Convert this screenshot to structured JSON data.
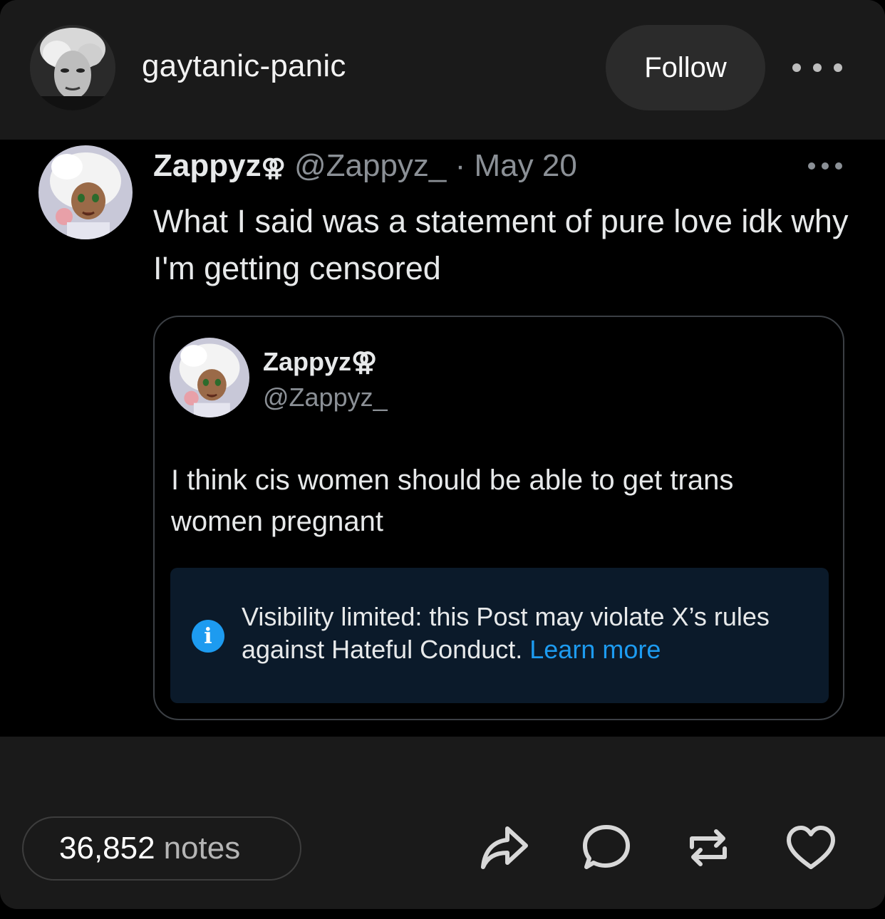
{
  "header": {
    "blog_name": "gaytanic-panic",
    "follow_label": "Follow"
  },
  "tweet": {
    "display_name": "Zappyz",
    "name_symbol": "⚢",
    "handle": "@Zappyz_",
    "separator": "·",
    "date": "May 20",
    "text": "What I said was a statement of pure love idk why I'm getting censored",
    "quote": {
      "display_name": "Zappyz",
      "name_symbol": "⚢",
      "handle": "@Zappyz_",
      "text": "I think cis women should be able to get trans women pregnant",
      "notice": {
        "text": "Visibility limited: this Post may violate X’s rules against Hateful Conduct.",
        "link": "Learn more"
      }
    }
  },
  "footer": {
    "notes_count": "36,852",
    "notes_label": "notes",
    "actions": [
      "share-icon",
      "reply-icon",
      "reblog-icon",
      "like-icon"
    ]
  },
  "colors": {
    "accent_blue": "#1d9bf0",
    "card_bg": "#1a1a1a",
    "notice_bg": "#0b1a2a"
  }
}
